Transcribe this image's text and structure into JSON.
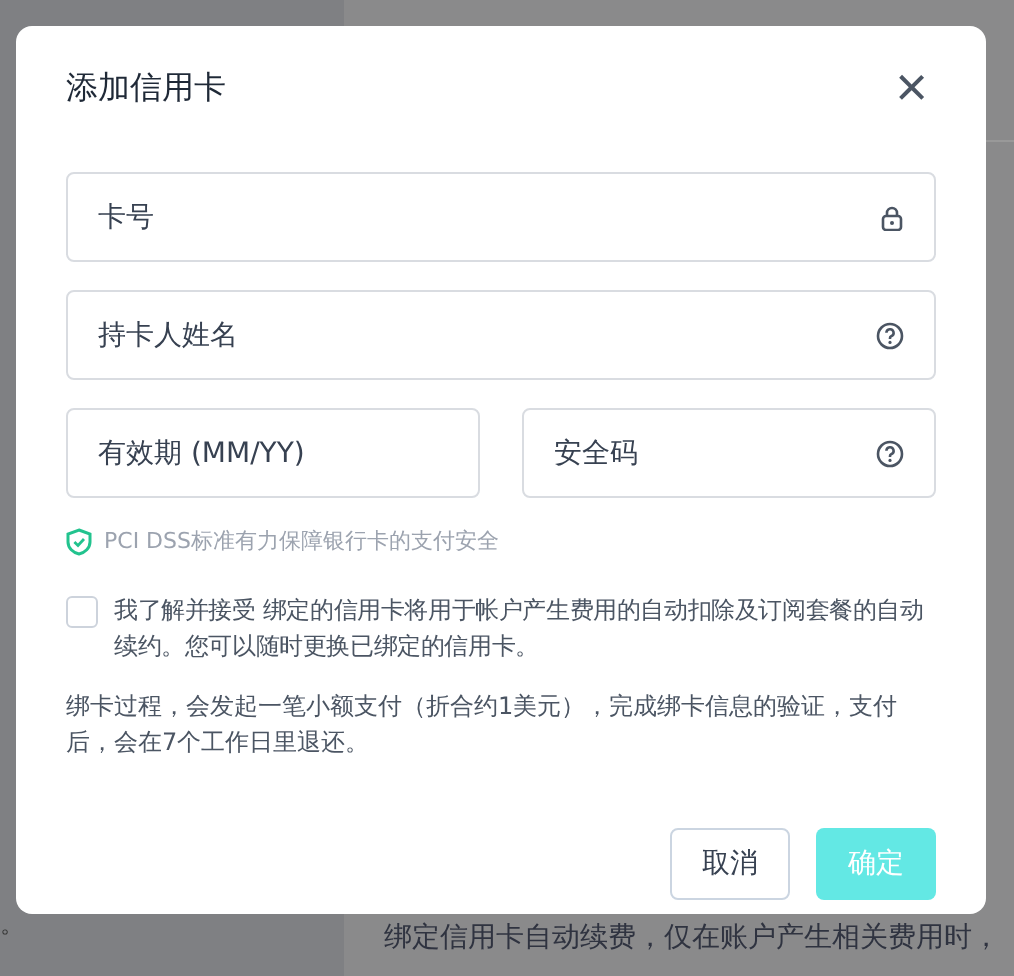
{
  "background": {
    "side_text": "。",
    "footer_text": "绑定信用卡自动续费，仅在账户产生相关费用时，"
  },
  "dialog": {
    "title": "添加信用卡",
    "close": "×",
    "fields": [
      {
        "placeholder": "卡号",
        "kind": "secure"
      },
      {
        "placeholder": "持卡人姓名",
        "kind": "hint"
      },
      {
        "placeholder": "有效期 (MM/YY)",
        "kind": "plain"
      },
      {
        "placeholder": "安全码",
        "kind": "hint"
      }
    ],
    "security_note": "PCI DSS标准有力保障银行卡的支付安全",
    "agreement": {
      "checked": false,
      "text": "我了解并接受 绑定的信用卡将用于帐户产生费用的自动扣除及订阅套餐的自动续约。您可以随时更换已绑定的信用卡。"
    },
    "notice": "绑卡过程，会发起一笔小额支付（折合约1美元），完成绑卡信息的验证，支付后，会在7个工作日里退还。",
    "buttons": [
      {
        "label": "取消",
        "kind": "secondary",
        "disabled": false
      },
      {
        "label": "确定",
        "kind": "primary",
        "disabled": true
      }
    ]
  }
}
